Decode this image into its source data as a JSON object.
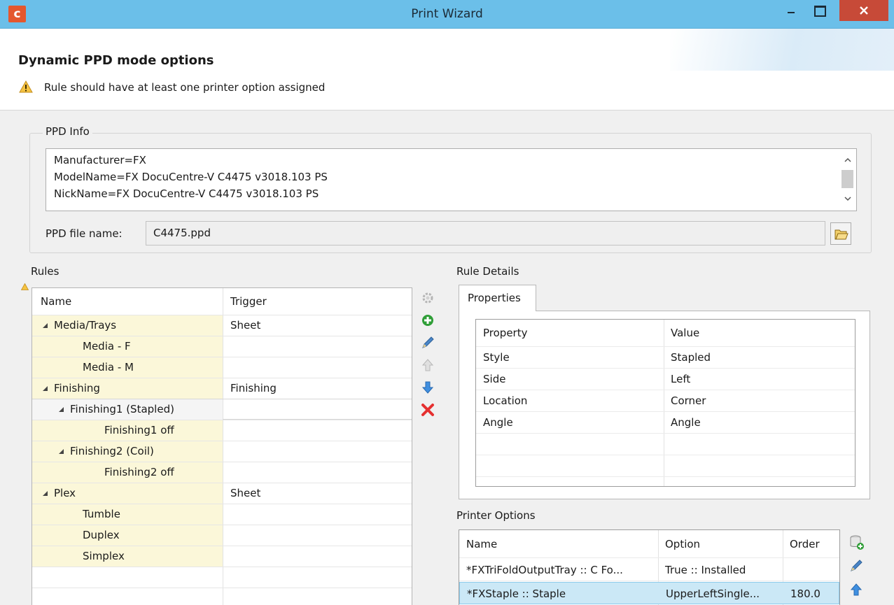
{
  "window": {
    "title": "Print Wizard",
    "app_icon_letter": "c"
  },
  "header": {
    "title": "Dynamic PPD mode options",
    "message": "Rule should have at least one printer option assigned"
  },
  "ppd_info": {
    "legend": "PPD Info",
    "lines": [
      "Manufacturer=FX",
      "ModelName=FX DocuCentre-V C4475 v3018.103 PS",
      "NickName=FX DocuCentre-V C4475 v3018.103 PS"
    ],
    "file_label": "PPD file name:",
    "file_value": "C4475.ppd"
  },
  "rules": {
    "label": "Rules",
    "columns": [
      "Name",
      "Trigger"
    ],
    "rows": [
      {
        "name": "Media/Trays",
        "trigger": "Sheet",
        "level": 0,
        "expanded": true
      },
      {
        "name": "Media - F",
        "trigger": "",
        "level": 2,
        "expanded": false
      },
      {
        "name": "Media - M",
        "trigger": "",
        "level": 2,
        "expanded": false
      },
      {
        "name": "Finishing",
        "trigger": "Finishing",
        "level": 0,
        "expanded": true
      },
      {
        "name": "Finishing1 (Stapled)",
        "trigger": "",
        "level": 1,
        "expanded": true,
        "selected": true
      },
      {
        "name": "Finishing1 off",
        "trigger": "",
        "level": 3,
        "expanded": false
      },
      {
        "name": "Finishing2 (Coil)",
        "trigger": "",
        "level": 1,
        "expanded": true
      },
      {
        "name": "Finishing2 off",
        "trigger": "",
        "level": 3,
        "expanded": false
      },
      {
        "name": "Plex",
        "trigger": "Sheet",
        "level": 0,
        "expanded": true
      },
      {
        "name": "Tumble",
        "trigger": "",
        "level": 2,
        "expanded": false
      },
      {
        "name": "Duplex",
        "trigger": "",
        "level": 2,
        "expanded": false
      },
      {
        "name": "Simplex",
        "trigger": "",
        "level": 2,
        "expanded": false
      }
    ]
  },
  "rule_details": {
    "label": "Rule Details",
    "tab": "Properties",
    "columns": [
      "Property",
      "Value"
    ],
    "rows": [
      {
        "property": "Style",
        "value": "Stapled"
      },
      {
        "property": "Side",
        "value": "Left"
      },
      {
        "property": "Location",
        "value": "Corner"
      },
      {
        "property": "Angle",
        "value": "Angle"
      }
    ]
  },
  "printer_options": {
    "label": "Printer Options",
    "columns": [
      "Name",
      "Option",
      "Order"
    ],
    "rows": [
      {
        "name": "*FXTriFoldOutputTray :: C Fo...",
        "option": "True :: Installed",
        "order": ""
      },
      {
        "name": "*FXStaple :: Staple",
        "option": "UpperLeftSingle...",
        "order": "180.0",
        "selected": true
      }
    ]
  },
  "colors": {
    "titlebar": "#6bbfe9",
    "close_button": "#c74a38",
    "rule_highlight": "#fbf7d9",
    "selection": "#cbe8f6"
  },
  "icons": {
    "rules_toolbar": [
      "gear-icon",
      "add-icon",
      "edit-pencil-icon",
      "move-up-icon",
      "move-down-icon",
      "delete-icon"
    ],
    "printer_options_toolbar": [
      "add-database-icon",
      "edit-pencil-icon",
      "move-up-icon"
    ]
  }
}
